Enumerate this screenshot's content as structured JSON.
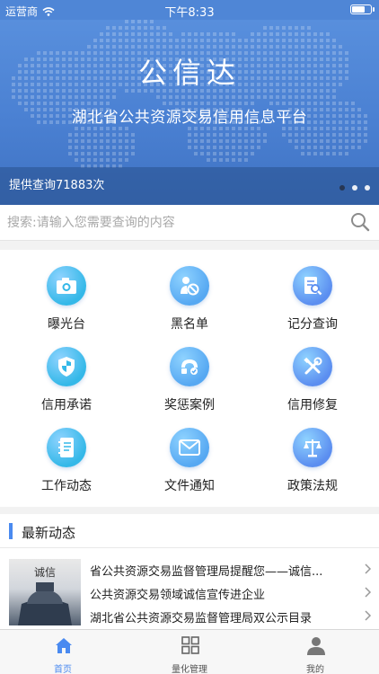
{
  "status": {
    "carrier": "运营商",
    "time": "下午8:33",
    "battery": 0.8
  },
  "banner": {
    "title": "公信达",
    "subtitle": "湖北省公共资源交易信用信息平台",
    "query_count": "提供查询71883次",
    "dots": 3,
    "active_dot": 0
  },
  "search": {
    "placeholder": "搜索:请输入您需要查询的内容"
  },
  "grid": {
    "items": [
      {
        "label": "曝光台",
        "icon": "camera-icon"
      },
      {
        "label": "黑名单",
        "icon": "blacklist-user-icon"
      },
      {
        "label": "记分查询",
        "icon": "score-search-icon"
      },
      {
        "label": "信用承诺",
        "icon": "shield-icon"
      },
      {
        "label": "奖惩案例",
        "icon": "reward-punish-icon"
      },
      {
        "label": "信用修复",
        "icon": "repair-tools-icon"
      },
      {
        "label": "工作动态",
        "icon": "notebook-icon"
      },
      {
        "label": "文件通知",
        "icon": "mail-icon"
      },
      {
        "label": "政策法规",
        "icon": "scales-icon"
      }
    ],
    "icon_colors": [
      "#34b8e8",
      "#56a8f2",
      "#5b8ef0"
    ]
  },
  "news": {
    "title": "最新动态",
    "thumb_text": "诚信",
    "items": [
      "省公共资源交易监督管理局提醒您——诚信...",
      "公共资源交易领域诚信宣传进企业",
      "湖北省公共资源交易监督管理局双公示目录"
    ]
  },
  "tabs": [
    {
      "label": "首页",
      "icon": "home-icon",
      "active": true
    },
    {
      "label": "量化管理",
      "icon": "grid-apps-icon",
      "active": false
    },
    {
      "label": "我的",
      "icon": "user-icon",
      "active": false
    }
  ],
  "colors": {
    "accent": "#4a8af0",
    "banner": "#4f86d6"
  }
}
